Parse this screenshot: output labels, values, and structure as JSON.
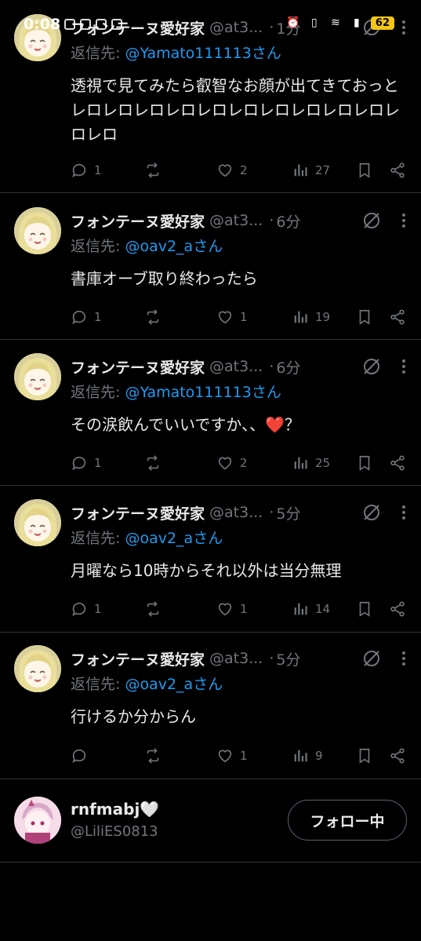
{
  "status_bar": {
    "time": "0:08",
    "battery": "62"
  },
  "tweets": [
    {
      "name": "フォンテーヌ愛好家",
      "handle": "@at3...",
      "time": "1分",
      "reply_prefix": "返信先: ",
      "reply_to": "@Yamato111113さん",
      "text": "透視で見てみたら叡智なお顔が出てきておっとレロレロレロレロレロレロレロレロレロレロレロレロ",
      "replies": "1",
      "retweets": "",
      "likes": "2",
      "views": "27"
    },
    {
      "name": "フォンテーヌ愛好家",
      "handle": "@at3...",
      "time": "6分",
      "reply_prefix": "返信先: ",
      "reply_to": "@oav2_aさん",
      "text": "書庫オーブ取り終わったら",
      "replies": "1",
      "retweets": "",
      "likes": "1",
      "views": "19"
    },
    {
      "name": "フォンテーヌ愛好家",
      "handle": "@at3...",
      "time": "6分",
      "reply_prefix": "返信先: ",
      "reply_to": "@Yamato111113さん",
      "text": "その涙飲んでいいですか、、",
      "text_emoji": "❤️",
      "text_after": "？",
      "replies": "1",
      "retweets": "",
      "likes": "2",
      "views": "25"
    },
    {
      "name": "フォンテーヌ愛好家",
      "handle": "@at3...",
      "time": "5分",
      "reply_prefix": "返信先: ",
      "reply_to": "@oav2_aさん",
      "text": "月曜なら10時からそれ以外は当分無理",
      "replies": "1",
      "retweets": "",
      "likes": "1",
      "views": "14"
    },
    {
      "name": "フォンテーヌ愛好家",
      "handle": "@at3...",
      "time": "5分",
      "reply_prefix": "返信先: ",
      "reply_to": "@oav2_aさん",
      "text": "行けるか分からん",
      "replies": "",
      "retweets": "",
      "likes": "1",
      "views": "9"
    }
  ],
  "follow_card": {
    "name": "rnfmabj🤍",
    "handle": "@LiliES0813",
    "button_label": "フォロー中"
  },
  "colors": {
    "link": "#1d9bf0",
    "muted": "#71767b",
    "divider": "#2f3336"
  }
}
